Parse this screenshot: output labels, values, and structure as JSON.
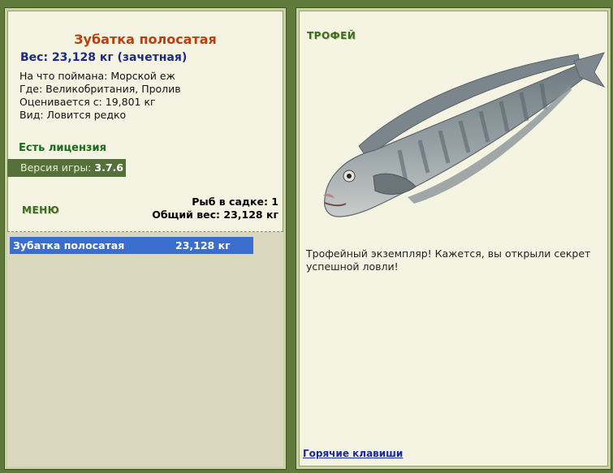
{
  "fish": {
    "name": "Зубатка полосатая",
    "weight_line": "Вес: 23,128 кг (зачетная)",
    "bait": "На что поймана: Морской еж",
    "location": "Где: Великобритания, Пролив",
    "value": "Оценивается с: 19,801 кг",
    "kind": "Вид: Ловится редко"
  },
  "license": "Есть лицензия",
  "version": {
    "label": "Версия игры:",
    "value": "3.7.6"
  },
  "menu": "МЕНЮ",
  "stats": {
    "count": "Рыб в садке: 1",
    "total": "Общий вес: 23,128 кг"
  },
  "catch_list": [
    {
      "name": "Зубатка полосатая",
      "weight": "23,128 кг"
    }
  ],
  "trophy": {
    "title": "ТРОФЕЙ",
    "text": "Трофейный экземпляр! Кажется, вы открыли секрет успешной ловли!"
  },
  "hotkeys": "Горячие клавиши",
  "colors": {
    "frame": "#5f7a3a",
    "panel": "#f5f3e2",
    "selection": "#3b6ecc",
    "title": "#b8400f"
  }
}
